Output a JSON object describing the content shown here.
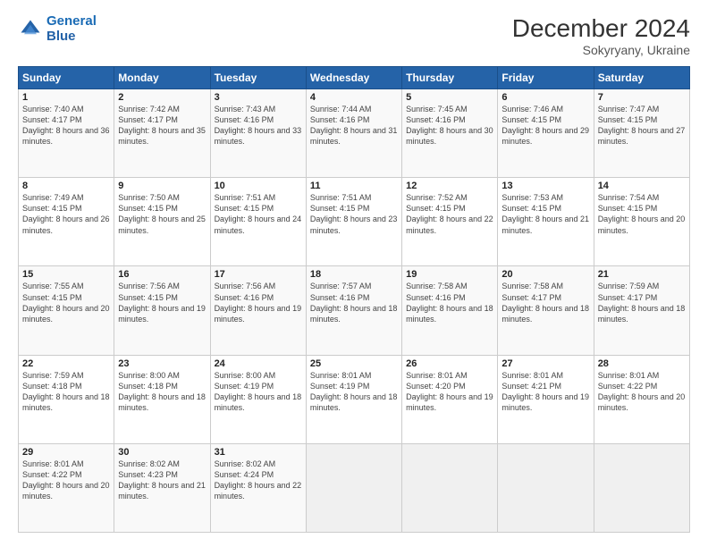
{
  "logo": {
    "line1": "General",
    "line2": "Blue"
  },
  "title": "December 2024",
  "subtitle": "Sokyryany, Ukraine",
  "days_header": [
    "Sunday",
    "Monday",
    "Tuesday",
    "Wednesday",
    "Thursday",
    "Friday",
    "Saturday"
  ],
  "weeks": [
    [
      {
        "num": "1",
        "sunrise": "Sunrise: 7:40 AM",
        "sunset": "Sunset: 4:17 PM",
        "daylight": "Daylight: 8 hours and 36 minutes."
      },
      {
        "num": "2",
        "sunrise": "Sunrise: 7:42 AM",
        "sunset": "Sunset: 4:17 PM",
        "daylight": "Daylight: 8 hours and 35 minutes."
      },
      {
        "num": "3",
        "sunrise": "Sunrise: 7:43 AM",
        "sunset": "Sunset: 4:16 PM",
        "daylight": "Daylight: 8 hours and 33 minutes."
      },
      {
        "num": "4",
        "sunrise": "Sunrise: 7:44 AM",
        "sunset": "Sunset: 4:16 PM",
        "daylight": "Daylight: 8 hours and 31 minutes."
      },
      {
        "num": "5",
        "sunrise": "Sunrise: 7:45 AM",
        "sunset": "Sunset: 4:16 PM",
        "daylight": "Daylight: 8 hours and 30 minutes."
      },
      {
        "num": "6",
        "sunrise": "Sunrise: 7:46 AM",
        "sunset": "Sunset: 4:15 PM",
        "daylight": "Daylight: 8 hours and 29 minutes."
      },
      {
        "num": "7",
        "sunrise": "Sunrise: 7:47 AM",
        "sunset": "Sunset: 4:15 PM",
        "daylight": "Daylight: 8 hours and 27 minutes."
      }
    ],
    [
      {
        "num": "8",
        "sunrise": "Sunrise: 7:49 AM",
        "sunset": "Sunset: 4:15 PM",
        "daylight": "Daylight: 8 hours and 26 minutes."
      },
      {
        "num": "9",
        "sunrise": "Sunrise: 7:50 AM",
        "sunset": "Sunset: 4:15 PM",
        "daylight": "Daylight: 8 hours and 25 minutes."
      },
      {
        "num": "10",
        "sunrise": "Sunrise: 7:51 AM",
        "sunset": "Sunset: 4:15 PM",
        "daylight": "Daylight: 8 hours and 24 minutes."
      },
      {
        "num": "11",
        "sunrise": "Sunrise: 7:51 AM",
        "sunset": "Sunset: 4:15 PM",
        "daylight": "Daylight: 8 hours and 23 minutes."
      },
      {
        "num": "12",
        "sunrise": "Sunrise: 7:52 AM",
        "sunset": "Sunset: 4:15 PM",
        "daylight": "Daylight: 8 hours and 22 minutes."
      },
      {
        "num": "13",
        "sunrise": "Sunrise: 7:53 AM",
        "sunset": "Sunset: 4:15 PM",
        "daylight": "Daylight: 8 hours and 21 minutes."
      },
      {
        "num": "14",
        "sunrise": "Sunrise: 7:54 AM",
        "sunset": "Sunset: 4:15 PM",
        "daylight": "Daylight: 8 hours and 20 minutes."
      }
    ],
    [
      {
        "num": "15",
        "sunrise": "Sunrise: 7:55 AM",
        "sunset": "Sunset: 4:15 PM",
        "daylight": "Daylight: 8 hours and 20 minutes."
      },
      {
        "num": "16",
        "sunrise": "Sunrise: 7:56 AM",
        "sunset": "Sunset: 4:15 PM",
        "daylight": "Daylight: 8 hours and 19 minutes."
      },
      {
        "num": "17",
        "sunrise": "Sunrise: 7:56 AM",
        "sunset": "Sunset: 4:16 PM",
        "daylight": "Daylight: 8 hours and 19 minutes."
      },
      {
        "num": "18",
        "sunrise": "Sunrise: 7:57 AM",
        "sunset": "Sunset: 4:16 PM",
        "daylight": "Daylight: 8 hours and 18 minutes."
      },
      {
        "num": "19",
        "sunrise": "Sunrise: 7:58 AM",
        "sunset": "Sunset: 4:16 PM",
        "daylight": "Daylight: 8 hours and 18 minutes."
      },
      {
        "num": "20",
        "sunrise": "Sunrise: 7:58 AM",
        "sunset": "Sunset: 4:17 PM",
        "daylight": "Daylight: 8 hours and 18 minutes."
      },
      {
        "num": "21",
        "sunrise": "Sunrise: 7:59 AM",
        "sunset": "Sunset: 4:17 PM",
        "daylight": "Daylight: 8 hours and 18 minutes."
      }
    ],
    [
      {
        "num": "22",
        "sunrise": "Sunrise: 7:59 AM",
        "sunset": "Sunset: 4:18 PM",
        "daylight": "Daylight: 8 hours and 18 minutes."
      },
      {
        "num": "23",
        "sunrise": "Sunrise: 8:00 AM",
        "sunset": "Sunset: 4:18 PM",
        "daylight": "Daylight: 8 hours and 18 minutes."
      },
      {
        "num": "24",
        "sunrise": "Sunrise: 8:00 AM",
        "sunset": "Sunset: 4:19 PM",
        "daylight": "Daylight: 8 hours and 18 minutes."
      },
      {
        "num": "25",
        "sunrise": "Sunrise: 8:01 AM",
        "sunset": "Sunset: 4:19 PM",
        "daylight": "Daylight: 8 hours and 18 minutes."
      },
      {
        "num": "26",
        "sunrise": "Sunrise: 8:01 AM",
        "sunset": "Sunset: 4:20 PM",
        "daylight": "Daylight: 8 hours and 19 minutes."
      },
      {
        "num": "27",
        "sunrise": "Sunrise: 8:01 AM",
        "sunset": "Sunset: 4:21 PM",
        "daylight": "Daylight: 8 hours and 19 minutes."
      },
      {
        "num": "28",
        "sunrise": "Sunrise: 8:01 AM",
        "sunset": "Sunset: 4:22 PM",
        "daylight": "Daylight: 8 hours and 20 minutes."
      }
    ],
    [
      {
        "num": "29",
        "sunrise": "Sunrise: 8:01 AM",
        "sunset": "Sunset: 4:22 PM",
        "daylight": "Daylight: 8 hours and 20 minutes."
      },
      {
        "num": "30",
        "sunrise": "Sunrise: 8:02 AM",
        "sunset": "Sunset: 4:23 PM",
        "daylight": "Daylight: 8 hours and 21 minutes."
      },
      {
        "num": "31",
        "sunrise": "Sunrise: 8:02 AM",
        "sunset": "Sunset: 4:24 PM",
        "daylight": "Daylight: 8 hours and 22 minutes."
      },
      null,
      null,
      null,
      null
    ]
  ]
}
